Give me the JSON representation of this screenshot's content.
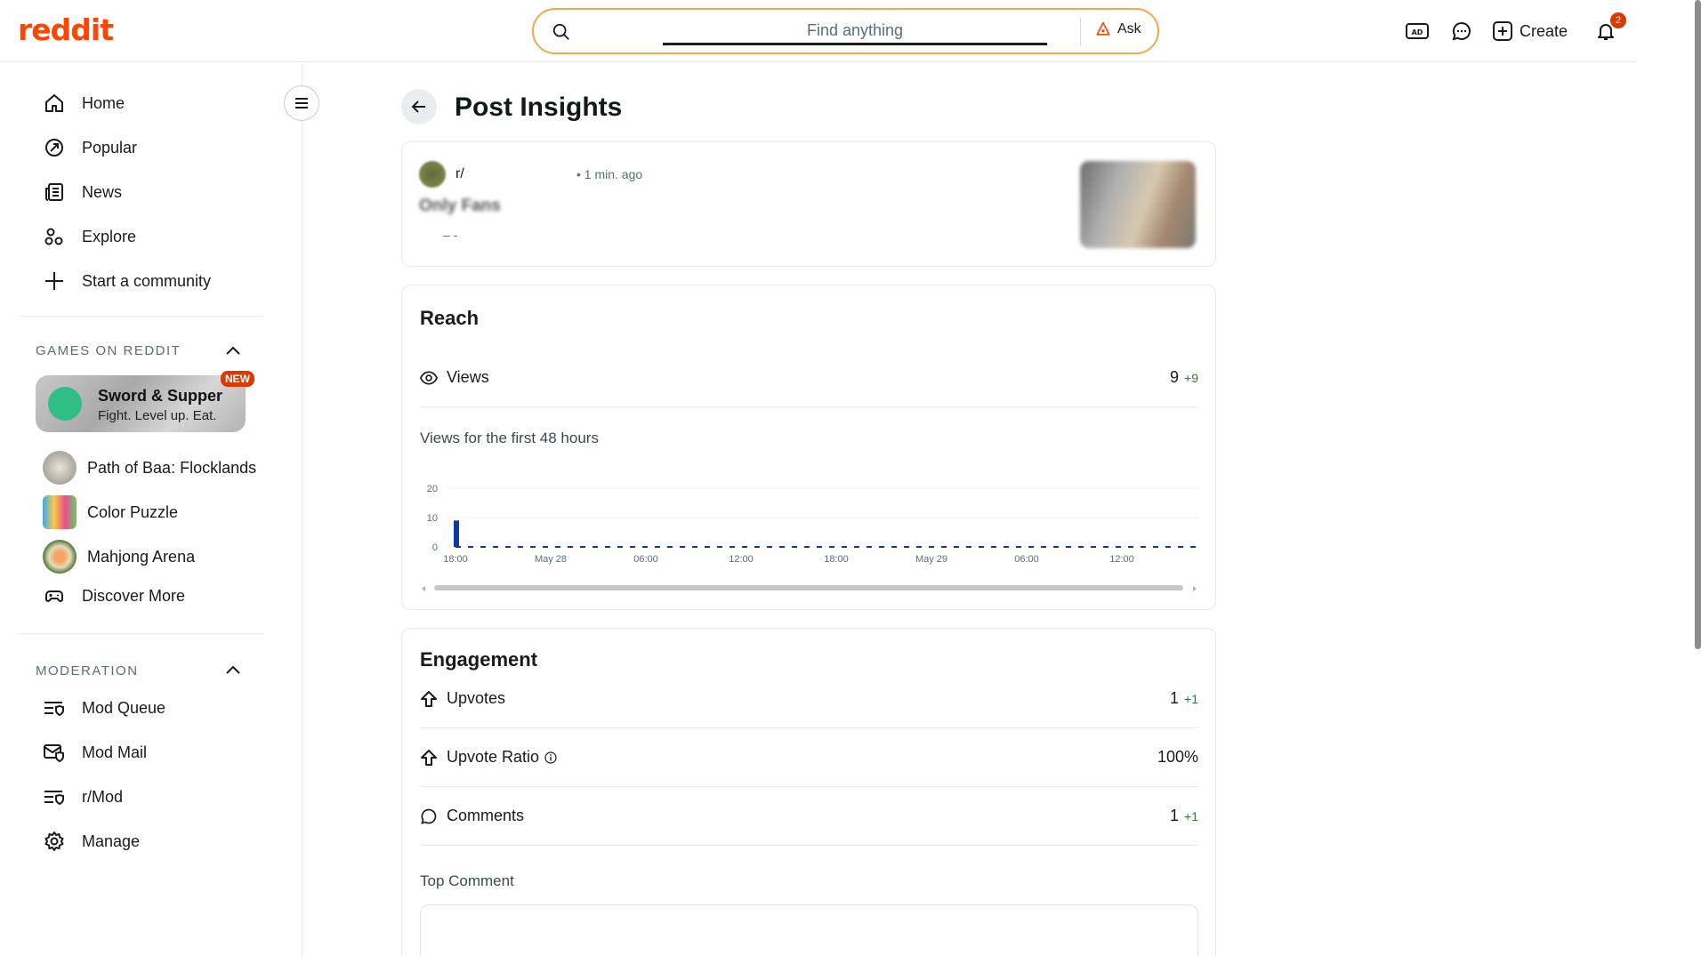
{
  "header": {
    "logo": "reddit",
    "search_placeholder": "Find anything",
    "ask_label": "Ask",
    "create_label": "Create",
    "notification_count": "2"
  },
  "sidebar": {
    "nav": [
      {
        "label": "Home",
        "icon": "home-icon"
      },
      {
        "label": "Popular",
        "icon": "popular-icon"
      },
      {
        "label": "News",
        "icon": "news-icon"
      },
      {
        "label": "Explore",
        "icon": "explore-icon"
      },
      {
        "label": "Start a community",
        "icon": "plus-icon"
      }
    ],
    "games_header": "GAMES ON REDDIT",
    "featured_game": {
      "title": "Sword & Supper",
      "subtitle": "Fight. Level up. Eat.",
      "badge": "NEW"
    },
    "games": [
      {
        "label": "Path of Baa: Flocklands"
      },
      {
        "label": "Color Puzzle"
      },
      {
        "label": "Mahjong Arena"
      },
      {
        "label": "Discover More"
      }
    ],
    "moderation_header": "MODERATION",
    "moderation": [
      {
        "label": "Mod Queue"
      },
      {
        "label": "Mod Mail"
      },
      {
        "label": "r/Mod"
      },
      {
        "label": "Manage"
      }
    ]
  },
  "main": {
    "title": "Post Insights",
    "post": {
      "subreddit": "r/",
      "time": "1 min. ago",
      "title": "Only Fans",
      "meta": "–    -"
    },
    "reach": {
      "heading": "Reach",
      "views_label": "Views",
      "views_value": "9",
      "views_delta": "+9",
      "chart_caption": "Views for the first 48 hours"
    },
    "engagement": {
      "heading": "Engagement",
      "upvotes_label": "Upvotes",
      "upvotes_value": "1",
      "upvotes_delta": "+1",
      "ratio_label": "Upvote Ratio",
      "ratio_value": "100%",
      "comments_label": "Comments",
      "comments_value": "1",
      "comments_delta": "+1",
      "top_comment_label": "Top Comment"
    }
  },
  "chart_data": {
    "type": "bar",
    "ylim": [
      0,
      20
    ],
    "yticks": [
      0,
      10,
      20
    ],
    "xtick_labels": [
      "18:00",
      "May 28",
      "06:00",
      "12:00",
      "18:00",
      "May 29",
      "06:00",
      "12:00"
    ],
    "values": [
      9
    ],
    "bar_color": "#0b3b9e",
    "grid": true
  }
}
